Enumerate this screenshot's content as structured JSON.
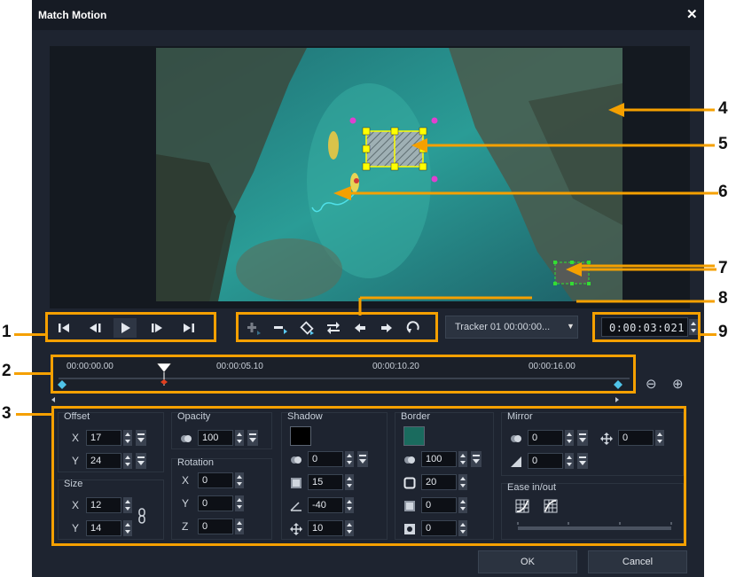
{
  "window": {
    "title": "Match Motion",
    "close_label": "✕"
  },
  "tracker": {
    "combo": "Tracker 01   00:00:00...",
    "time": "0:00:03:021"
  },
  "timeline": {
    "marks": [
      "00:00:00.00",
      "00:00:05.10",
      "00:00:10.20",
      "00:00:16.00"
    ]
  },
  "offset": {
    "label": "Offset",
    "x_label": "X",
    "x": "17",
    "y_label": "Y",
    "y": "24"
  },
  "size": {
    "label": "Size",
    "x_label": "X",
    "x": "12",
    "y_label": "Y",
    "y": "14"
  },
  "opacity": {
    "label": "Opacity",
    "value": "100"
  },
  "rotation": {
    "label": "Rotation",
    "x_label": "X",
    "x": "0",
    "y_label": "Y",
    "y": "0",
    "z_label": "Z",
    "z": "0"
  },
  "shadow": {
    "label": "Shadow",
    "color": "#000000",
    "opacity": "0",
    "blur": "15",
    "angle": "-40",
    "distance": "10"
  },
  "border": {
    "label": "Border",
    "color": "#1a6b5e",
    "opacity": "100",
    "width": "20",
    "v1": "0",
    "v2": "0"
  },
  "mirror": {
    "label": "Mirror",
    "opacity": "0",
    "distance": "0",
    "fade": "0"
  },
  "ease": {
    "label": "Ease in/out"
  },
  "buttons": {
    "ok": "OK",
    "cancel": "Cancel"
  },
  "callouts": [
    "1",
    "2",
    "3",
    "4",
    "5",
    "6",
    "7",
    "8",
    "9"
  ],
  "colors": {
    "accent": "#f5a000",
    "dialog_bg": "#1e2430"
  }
}
